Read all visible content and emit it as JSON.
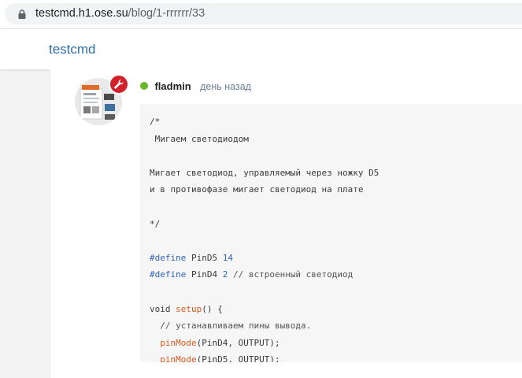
{
  "browser": {
    "url_host": "testcmd.h1.ose.su",
    "url_path": "/blog/1-rrrrrr/33"
  },
  "site": {
    "brand": "testcmd"
  },
  "post": {
    "author": "fladmin",
    "time": "день назад",
    "online_status_color": "#68b72a",
    "badge_icon": "wrench-icon",
    "code_lines": [
      [
        {
          "t": "/*"
        }
      ],
      [
        {
          "t": " Мигаем светодиодом"
        }
      ],
      [],
      [
        {
          "t": "Мигает светодиод, управляемый через ножку D5"
        }
      ],
      [
        {
          "t": "и в противофазе мигает светодиод на плате"
        }
      ],
      [],
      [
        {
          "t": "*/"
        }
      ],
      [],
      [
        {
          "t": "#define",
          "c": "pp"
        },
        {
          "t": " PinD5 "
        },
        {
          "t": "14",
          "c": "num"
        }
      ],
      [
        {
          "t": "#define",
          "c": "pp"
        },
        {
          "t": " PinD4 "
        },
        {
          "t": "2",
          "c": "num"
        },
        {
          "t": " // встроенный светодиод",
          "c": "cm"
        }
      ],
      [],
      [
        {
          "t": "void "
        },
        {
          "t": "setup",
          "c": "fn"
        },
        {
          "t": "() {"
        }
      ],
      [
        {
          "t": "  // устанавливаем пины вывода.",
          "c": "cm"
        }
      ],
      [
        {
          "t": "  "
        },
        {
          "t": "pinMode",
          "c": "fn"
        },
        {
          "t": "(PinD4, OUTPUT);"
        }
      ],
      [
        {
          "t": "  "
        },
        {
          "t": "pinMode",
          "c": "fn"
        },
        {
          "t": "(PinD5, OUTPUT);"
        }
      ]
    ]
  },
  "colors": {
    "brand": "#2f6fa8",
    "keyword": "#2e63b8",
    "function": "#d5591d",
    "badge": "#d3202a"
  }
}
